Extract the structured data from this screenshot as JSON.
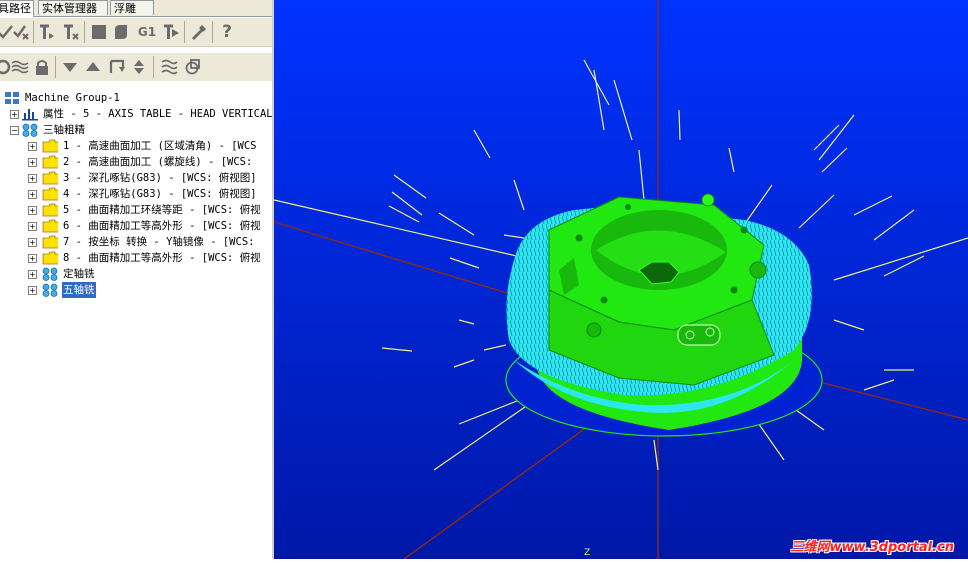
{
  "tabs": [
    {
      "label": "具路径",
      "active": true
    },
    {
      "label": "实体管理器",
      "active": false
    },
    {
      "label": "浮雕",
      "active": false
    }
  ],
  "toolbar": {
    "row1": [
      "select-all-icon",
      "verify-icon",
      "toolpath-t-icon",
      "toolpath-tx-icon",
      "stop-icon",
      "lock-icon",
      "g1-icon",
      "gcode-post-icon",
      "wand-icon",
      "help-icon"
    ],
    "row1_g1_label": "G1",
    "row1_help_label": "?",
    "row2": [
      "cycle-icon",
      "wave-icon",
      "lock-icon",
      "move-down-icon",
      "move-up-icon",
      "insert-icon",
      "reorder-icon",
      "zigzag-icon",
      "regen-icon"
    ]
  },
  "tree": {
    "root": "Machine Group-1",
    "properties": "属性 - 5 - AXIS TABLE - HEAD VERTICAL",
    "group_rough": "三轴粗精",
    "ops": [
      "1 - 高速曲面加工 (区域清角) - [WCS",
      "2 - 高速曲面加工 (螺旋线) - [WCS:",
      "3 - 深孔啄钻(G83) - [WCS: 俯视图]",
      "4 - 深孔啄钻(G83) - [WCS: 俯视图]",
      "5 - 曲面精加工环绕等距 - [WCS: 俯视",
      "6 - 曲面精加工等高外形 - [WCS: 俯视",
      "7 - 按坐标 转换 - Y轴镜像 - [WCS:",
      "8 - 曲面精加工等高外形 - [WCS: 俯视"
    ],
    "group_fixed": "定轴铣",
    "group_five": "五轴铣"
  },
  "viewport": {
    "axis_label": "Z",
    "watermark": "三维网www.3dportal.cn",
    "bg_top": "#0033ff",
    "bg_bottom": "#0018a8",
    "part_color": "#22e812",
    "toolpath_color": "#2ee6f0",
    "vector_color": "#f0f08a",
    "axis_color": "#8a2b1a"
  }
}
